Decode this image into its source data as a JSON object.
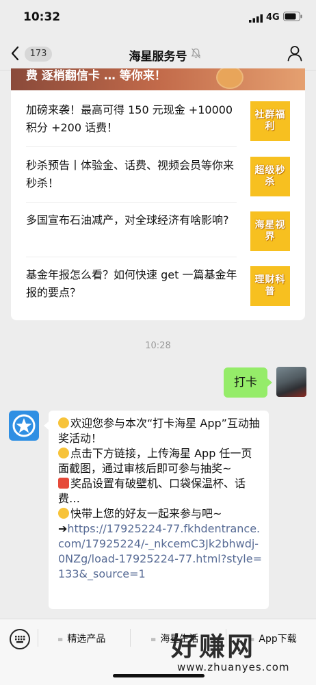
{
  "status": {
    "time": "10:32",
    "network": "4G"
  },
  "nav": {
    "unread_count": "173",
    "title": "海星服务号"
  },
  "banner": {
    "text": "费 逐梢翻信卡 … 等你来！"
  },
  "articles": [
    {
      "title": "加磅来袭！最高可得 150 元现金 +10000 积分 +200 话费！",
      "thumb": "社群福利"
    },
    {
      "title": "秒杀预告丨体验金、话费、视频会员等你来秒杀！",
      "thumb": "超级秒杀"
    },
    {
      "title": "多国宣布石油减产，对全球经济有啥影响?",
      "thumb": "海星视界"
    },
    {
      "title": "基金年报怎么看？如何快速 get 一篇基金年报的要点？",
      "thumb": "理财科普"
    }
  ],
  "chat": {
    "timestamp": "10:28",
    "my_message": "打卡",
    "reply": {
      "line1": "欢迎您参与本次“打卡海星 App”互动抽奖活动！",
      "line2": "点击下方链接，上传海星 App 任一页面截图，通过审核后即可参与抽奖~",
      "line3": "奖品设置有破壁机、口袋保温杯、话费…",
      "line4": "快带上您的好友一起来参与吧~",
      "arrow": "➔",
      "link": "https://17925224-77.fkhdentrance.com/17925224/-_nkcemC3Jk2bhwdj-0NZg/load-17925224-77.html?style=133&_source=1"
    }
  },
  "bottom_menu": {
    "item1": "精选产品",
    "item2": "海星生活",
    "item3": "App下载"
  },
  "watermark": {
    "text": "好赚网",
    "url": "www.zhuanyes.com"
  },
  "colors": {
    "my_bubble": "#95ec69",
    "link": "#576b95",
    "thumb_bg": "#f7c020",
    "background": "#ededed"
  }
}
